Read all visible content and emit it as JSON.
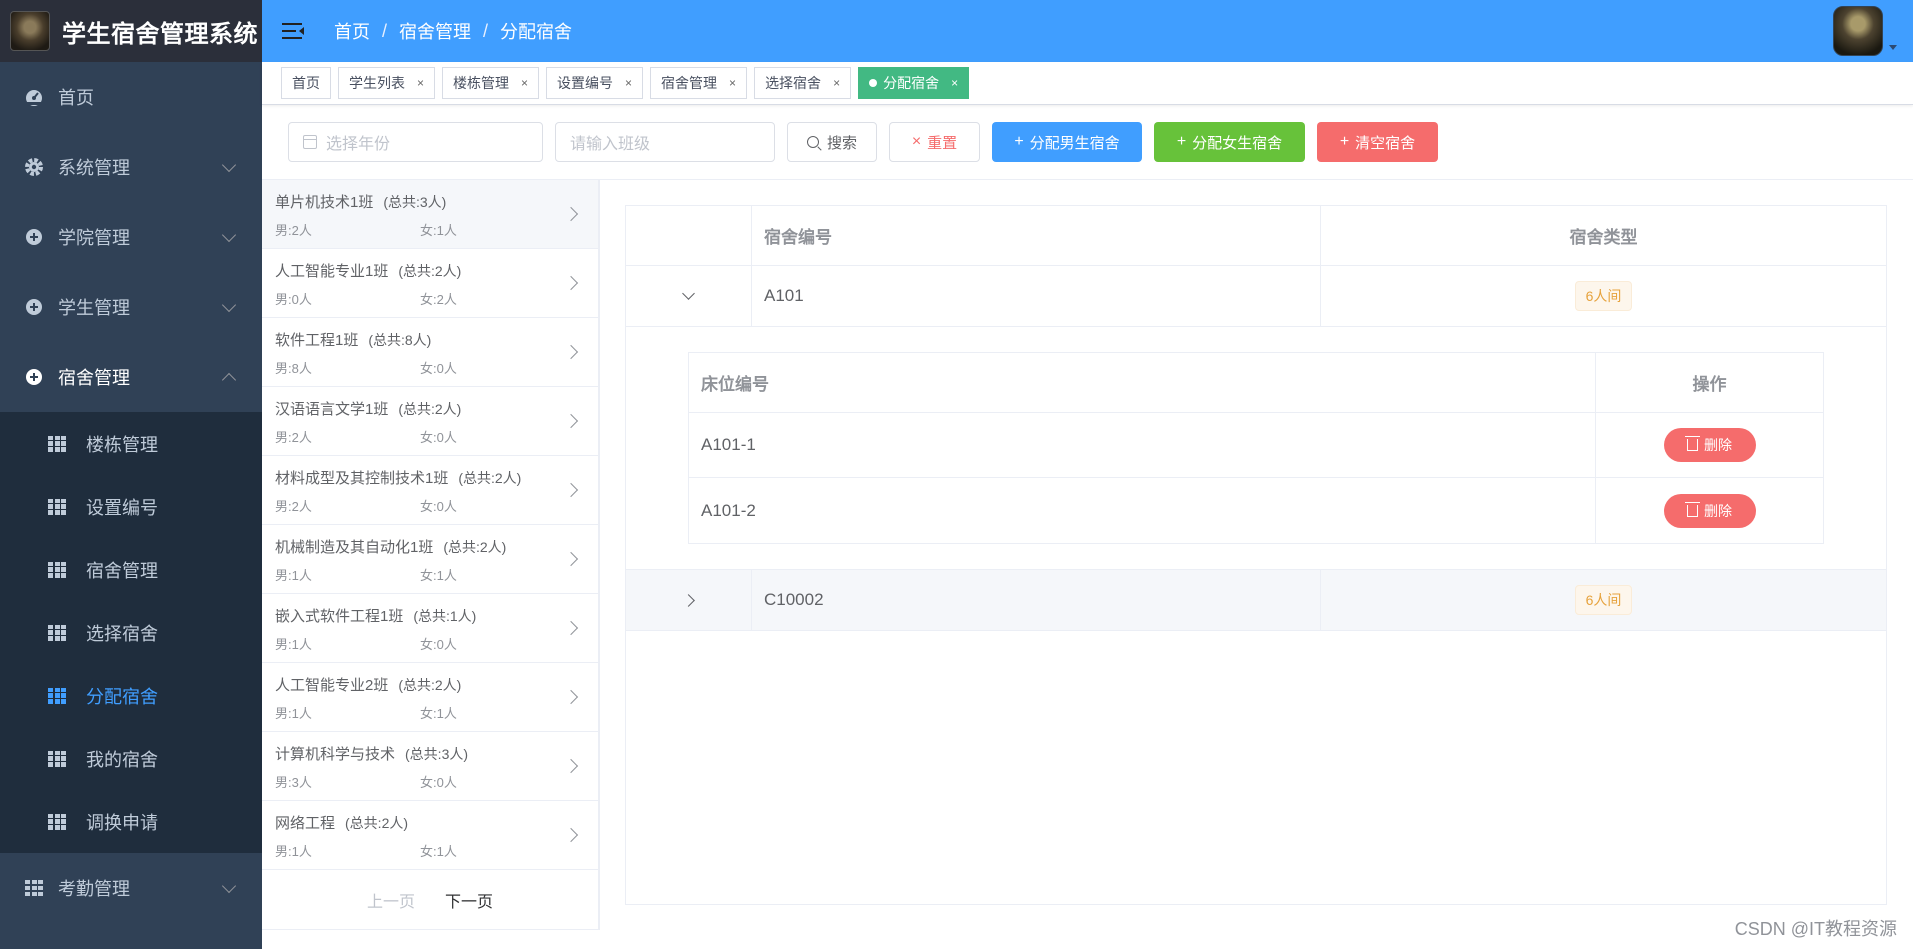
{
  "app": {
    "title": "学生宿舍管理系统"
  },
  "sidebar": {
    "items": [
      {
        "label": "首页",
        "icon": "dashboard-icon"
      },
      {
        "label": "系统管理",
        "icon": "gear-icon"
      },
      {
        "label": "学院管理",
        "icon": "circle-plus-icon"
      },
      {
        "label": "学生管理",
        "icon": "circle-plus-icon"
      },
      {
        "label": "宿舍管理",
        "icon": "circle-plus-icon"
      }
    ],
    "submenu": [
      {
        "label": "楼栋管理"
      },
      {
        "label": "设置编号"
      },
      {
        "label": "宿舍管理"
      },
      {
        "label": "选择宿舍"
      },
      {
        "label": "分配宿舍"
      },
      {
        "label": "我的宿舍"
      },
      {
        "label": "调换申请"
      }
    ],
    "after": [
      {
        "label": "考勤管理"
      }
    ]
  },
  "navbar": {
    "breadcrumb": [
      "首页",
      "宿舍管理",
      "分配宿舍"
    ]
  },
  "tags": [
    "首页",
    "学生列表",
    "楼栋管理",
    "设置编号",
    "宿舍管理",
    "选择宿舍",
    "分配宿舍"
  ],
  "toolbar": {
    "year_placeholder": "选择年份",
    "class_placeholder": "请输入班级",
    "search_label": "搜索",
    "reset_label": "重置",
    "assign_male_label": "分配男生宿舍",
    "assign_female_label": "分配女生宿舍",
    "clear_label": "清空宿舍"
  },
  "classes": [
    {
      "name": "单片机技术1班",
      "total": "(总共:3人)",
      "male": "男:2人",
      "female": "女:1人"
    },
    {
      "name": "人工智能专业1班",
      "total": "(总共:2人)",
      "male": "男:0人",
      "female": "女:2人"
    },
    {
      "name": "软件工程1班",
      "total": "(总共:8人)",
      "male": "男:8人",
      "female": "女:0人"
    },
    {
      "name": "汉语语言文学1班",
      "total": "(总共:2人)",
      "male": "男:2人",
      "female": "女:0人"
    },
    {
      "name": "材料成型及其控制技术1班",
      "total": "(总共:2人)",
      "male": "男:2人",
      "female": "女:0人"
    },
    {
      "name": "机械制造及其自动化1班",
      "total": "(总共:2人)",
      "male": "男:1人",
      "female": "女:1人"
    },
    {
      "name": "嵌入式软件工程1班",
      "total": "(总共:1人)",
      "male": "男:1人",
      "female": "女:0人"
    },
    {
      "name": "人工智能专业2班",
      "total": "(总共:2人)",
      "male": "男:1人",
      "female": "女:1人"
    },
    {
      "name": "计算机科学与技术",
      "total": "(总共:3人)",
      "male": "男:3人",
      "female": "女:0人"
    },
    {
      "name": "网络工程",
      "total": "(总共:2人)",
      "male": "男:1人",
      "female": "女:1人"
    }
  ],
  "pager": {
    "prev": "上一页",
    "next": "下一页"
  },
  "table": {
    "headers": {
      "dorm_no": "宿舍编号",
      "dorm_type": "宿舍类型"
    },
    "rows": [
      {
        "dorm_no": "A101",
        "type": "6人间"
      },
      {
        "dorm_no": "C10002",
        "type": "6人间"
      }
    ],
    "inner": {
      "headers": {
        "bed_no": "床位编号",
        "op": "操作"
      },
      "rows": [
        {
          "bed_no": "A101-1",
          "delete": "删除"
        },
        {
          "bed_no": "A101-2",
          "delete": "删除"
        }
      ]
    }
  },
  "watermark": "CSDN @IT教程资源"
}
